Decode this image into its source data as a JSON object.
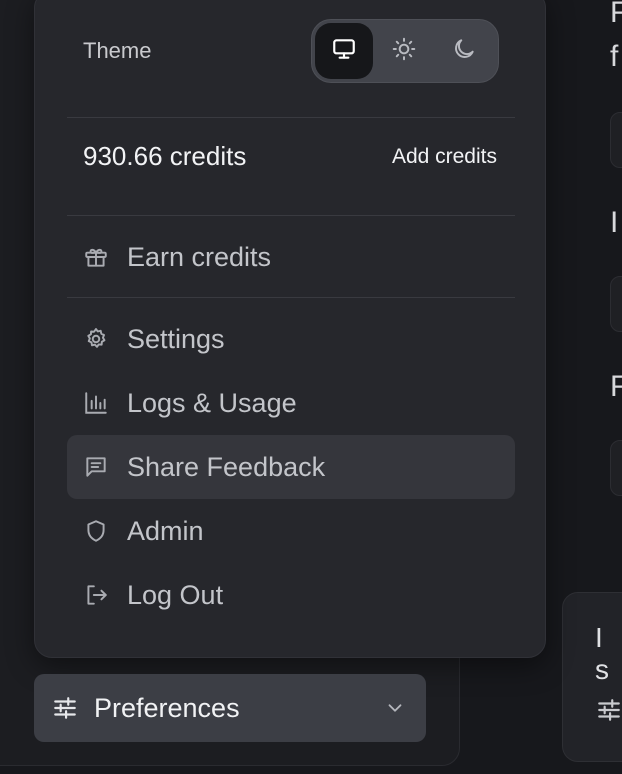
{
  "theme": {
    "label": "Theme",
    "options": [
      {
        "name": "system",
        "icon": "monitor-icon",
        "active": true
      },
      {
        "name": "light",
        "icon": "sun-icon",
        "active": false
      },
      {
        "name": "dark",
        "icon": "moon-icon",
        "active": false
      }
    ]
  },
  "credits": {
    "value": "930.66 credits",
    "add_label": "Add credits"
  },
  "menu": {
    "earn": {
      "label": "Earn credits",
      "icon": "gift-icon"
    },
    "settings": {
      "label": "Settings",
      "icon": "gear-icon"
    },
    "logs": {
      "label": "Logs & Usage",
      "icon": "bar-chart-icon"
    },
    "feedback": {
      "label": "Share Feedback",
      "icon": "message-square-icon"
    },
    "admin": {
      "label": "Admin",
      "icon": "shield-icon"
    },
    "logout": {
      "label": "Log Out",
      "icon": "log-out-icon"
    }
  },
  "preferences": {
    "label": "Preferences",
    "icon": "sliders-icon"
  },
  "background": {
    "card_text": "I s"
  },
  "colors": {
    "menu_bg": "#26272c",
    "hover_bg": "#35363c",
    "active_toggle": "#16171a",
    "prefs_bg": "#3c3e45"
  }
}
